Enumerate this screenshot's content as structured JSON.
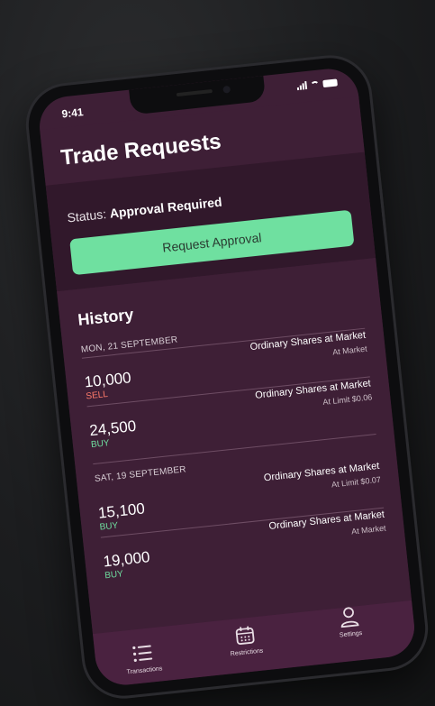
{
  "status_bar": {
    "time": "9:41"
  },
  "header": {
    "title": "Trade Requests"
  },
  "status_card": {
    "label": "Status:",
    "value": "Approval Required",
    "button_label": "Request Approval"
  },
  "history": {
    "title": "History",
    "groups": [
      {
        "date": "MON, 21 SEPTEMBER",
        "rows": [
          {
            "desc": "Ordinary Shares at Market",
            "sub": "At Market",
            "qty": "10,000",
            "side": "SELL"
          },
          {
            "desc": "Ordinary Shares at Market",
            "sub": "At Limit $0.06",
            "qty": "24,500",
            "side": "BUY"
          }
        ]
      },
      {
        "date": "SAT, 19 SEPTEMBER",
        "rows": [
          {
            "desc": "Ordinary Shares at Market",
            "sub": "At Limit $0.07",
            "qty": "15,100",
            "side": "BUY"
          },
          {
            "desc": "Ordinary Shares at Market",
            "sub": "At Market",
            "qty": "19,000",
            "side": "BUY"
          }
        ]
      }
    ]
  },
  "tabbar": {
    "tabs": [
      {
        "label": "Transactions",
        "icon": "list-icon"
      },
      {
        "label": "Restrictions",
        "icon": "calendar-icon"
      },
      {
        "label": "Settings",
        "icon": "person-icon"
      }
    ]
  },
  "colors": {
    "background": "#3e1f36",
    "card": "#31182b",
    "accent_green": "#6fe0a0",
    "sell_red": "#ff7b6b",
    "tabbar": "#4a2240"
  }
}
